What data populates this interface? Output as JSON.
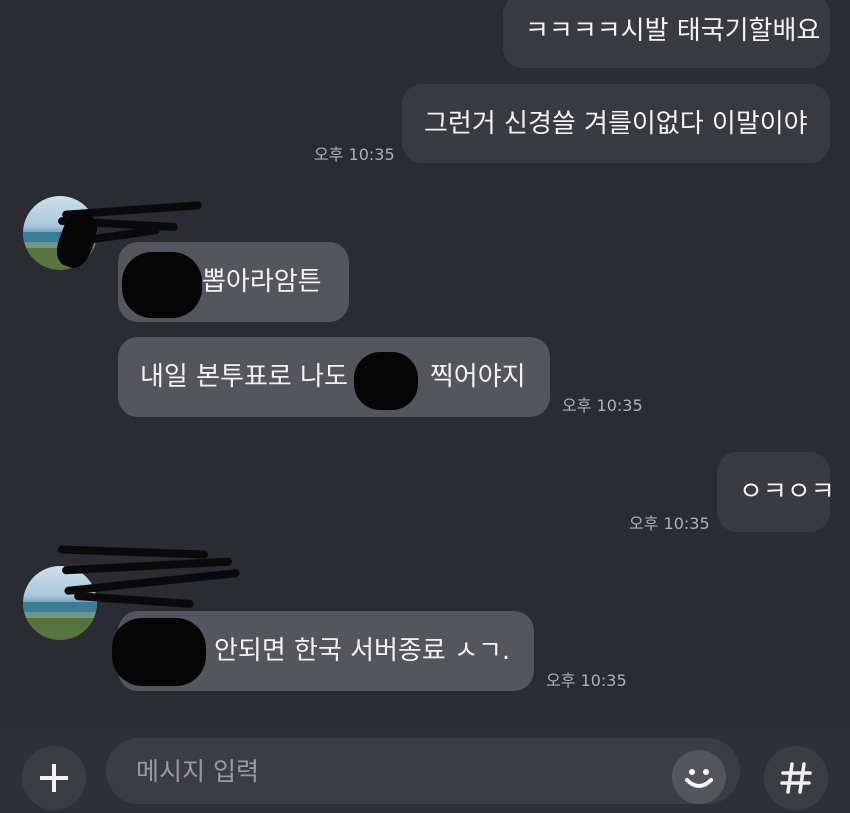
{
  "messages": [
    {
      "id": "m1",
      "text": "ㅋㅋㅋㅋ시발 태국기할배요",
      "sender": "me"
    },
    {
      "id": "m2",
      "text": "그런거 신경쓸 겨를이없다 이말이야",
      "sender": "me",
      "time": "오후 10:35"
    },
    {
      "id": "m3",
      "text": "뽑아라암튼",
      "sender": "other"
    },
    {
      "id": "m4_before",
      "text": "내일 본투표로 나도",
      "sender": "other"
    },
    {
      "id": "m4_after",
      "text": "찍어야지",
      "sender": "other",
      "time": "오후 10:35"
    },
    {
      "id": "m5",
      "text": "ㅇㅋㅇㅋ",
      "sender": "me",
      "time": "오후 10:35"
    },
    {
      "id": "m6",
      "text": "안되면 한국 서버종료 ㅅㄱ.",
      "sender": "other",
      "time": "오후 10:35"
    }
  ],
  "times": {
    "t1": "오후 10:35",
    "t2": "오후 10:35",
    "t3": "오후 10:35",
    "t4": "오후 10:35"
  },
  "input": {
    "placeholder": "메시지 입력",
    "value": ""
  },
  "icons": {
    "add": "plus-icon",
    "emoji": "smiley-icon",
    "hash": "hash-icon"
  },
  "colors": {
    "background": "#2b2c31",
    "my_bubble": "#3a3b41",
    "their_bubble": "#55565c",
    "text": "#f3f3f5",
    "timestamp": "#aeb0b6"
  }
}
